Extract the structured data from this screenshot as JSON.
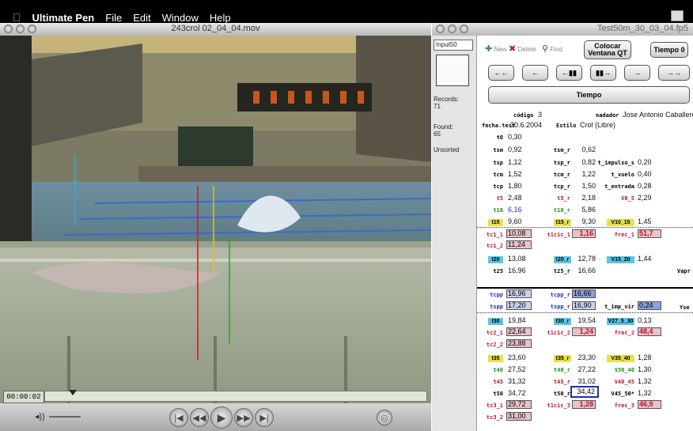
{
  "menubar": {
    "app": "Ultimate Pen",
    "items": [
      "File",
      "Edit",
      "Window",
      "Help"
    ]
  },
  "video": {
    "title": "243crol 02_04_04.mov",
    "timecode": "00:00:02"
  },
  "db": {
    "title": "Test50m_30_03_04.fp5",
    "layout": "Input50",
    "records_label": "Records:",
    "records": "71",
    "found_label": "Found:",
    "found": "65",
    "sort": "Unsorted",
    "toolbar": {
      "new": "New",
      "delete": "Delete",
      "find": "Find",
      "colocar": "Colocar Ventana QT",
      "tiempo0": "Tiempo 0",
      "tiempo": "Tiempo"
    },
    "nav": [
      "←←",
      "←",
      "←▮▮",
      "▮▮→",
      "→",
      "→→"
    ],
    "header": {
      "codigo_label": "código",
      "codigo": "3",
      "nadador_label": "nadador",
      "nadador": "Jose Antonio Caballero C",
      "fecha_label": "fecha.test",
      "fecha": "30.6.2004",
      "estilo_label": "Estilo",
      "estilo": "Crol (Libre)"
    },
    "rows": {
      "t0": {
        "l": "t0",
        "v": "0,30"
      },
      "tsm": {
        "l": "tsm",
        "v": "0,92",
        "l2": "tsm_r",
        "v2": "0,62"
      },
      "tsp": {
        "l": "tsp",
        "v": "1,12",
        "l2": "tsp_r",
        "v2": "0,82",
        "l3": "t_impulso_s",
        "v3": "0,20"
      },
      "tcm": {
        "l": "tcm",
        "v": "1,52",
        "l2": "tcm_r",
        "v2": "1,22",
        "l3": "t_vuelo",
        "v3": "0,40"
      },
      "tcp": {
        "l": "tcp",
        "v": "1,80",
        "l2": "tcp_r",
        "v2": "1,50",
        "l3": "t_entrada",
        "v3": "0,28"
      },
      "t5": {
        "l": "t5",
        "v": "2,48",
        "l2": "t5_r",
        "v2": "2,18",
        "l3": "V0_5",
        "v3": "2,29"
      },
      "t10": {
        "l": "t10",
        "v": "6,16",
        "l2": "t10_r",
        "v2": "5,86"
      },
      "t15": {
        "l": "t15",
        "v": "9,60",
        "l2": "t15_r",
        "v2": "9,30",
        "l3": "V10_15",
        "v3": "1,45"
      },
      "tc1_1": {
        "l": "tc1_1",
        "v": "10,08",
        "l2": "t1cic_1",
        "v2": "1,16",
        "l3": "frec_1",
        "v3": "51,7"
      },
      "tc1_2": {
        "l": "tc1_2",
        "v": "11,24"
      },
      "t20": {
        "l": "t20",
        "v": "13,08",
        "l2": "t20_r",
        "v2": "12,78",
        "l3": "V15_20",
        "v3": "1,44"
      },
      "t25": {
        "l": "t25",
        "v": "16,96",
        "l2": "t25_r",
        "v2": "16,66",
        "l3": "Vapr"
      },
      "tcpp": {
        "l": "tcpp",
        "v": "16,96",
        "l2": "tcpp_r",
        "v2": "16,66"
      },
      "tspp": {
        "l": "tspp",
        "v": "17,20",
        "l2": "tspp_r",
        "v2": "16,90",
        "l3": "t_imp_vir",
        "v3": "0,24",
        "l4": "Yse"
      },
      "t30": {
        "l": "t30",
        "v": "19,84",
        "l2": "t30_r",
        "v2": "19,54",
        "l3": "V27_5_30",
        "v3": "0,13"
      },
      "tc2_1": {
        "l": "tc2_1",
        "v": "22,64",
        "l2": "t1cic_2",
        "v2": "1,24",
        "l3": "frec_2",
        "v3": "48,4"
      },
      "tc2_2": {
        "l": "tc2_2",
        "v": "23,88"
      },
      "t35": {
        "l": "t35",
        "v": "23,60",
        "l2": "t35_r",
        "v2": "23,30",
        "l3": "V35_40",
        "v3": "1,28"
      },
      "t40": {
        "l": "t40",
        "v": "27,52",
        "l2": "t40_r",
        "v2": "27,22",
        "l3": "V30_40",
        "v3": "1,30"
      },
      "t45": {
        "l": "t45",
        "v": "31,32",
        "l2": "t45_r",
        "v2": "31,02",
        "l3": "V40_45",
        "v3": "1,32"
      },
      "t50": {
        "l": "t50",
        "v": "34,72",
        "l2": "t50_r",
        "v2": "34,42",
        "l3": "V45_50*",
        "v3": "1,32"
      },
      "tc3_1": {
        "l": "tc3_1",
        "v": "29,72",
        "l2": "t1cic_3",
        "v2": "1,28",
        "l3": "frec_3",
        "v3": "46,9"
      },
      "tc3_2": {
        "l": "tc3_2",
        "v": "31,00"
      }
    }
  },
  "colors": {
    "pink": "#e9c3c9",
    "blue_box": "#c9d2ee",
    "yellow": "#e8e04a",
    "cyan": "#58c6e6",
    "green_label": "#1f8a1f",
    "red_label": "#c0102c",
    "blue_label": "#1c2fb0"
  }
}
